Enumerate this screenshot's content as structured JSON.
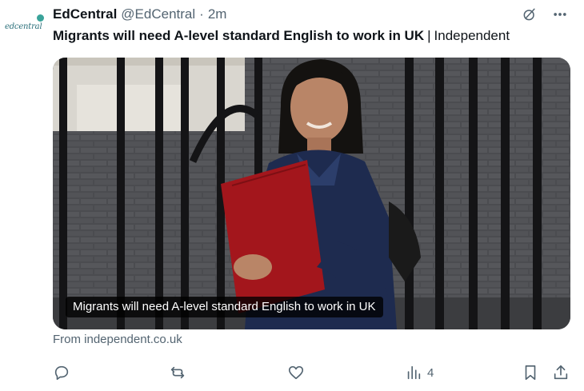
{
  "account": {
    "logo_text": "edcentral",
    "name": "EdCentral",
    "handle": "@EdCentral",
    "separator": "·",
    "time": "2m"
  },
  "header_icons": [
    "grok-icon",
    "more-icon"
  ],
  "tweet": {
    "headline": "Migrants will need A-level standard English to work in UK",
    "separator": "|",
    "publisher": "Independent"
  },
  "card": {
    "caption": "Migrants will need A-level standard English to work in UK",
    "source": "From independent.co.uk"
  },
  "actions": {
    "reply_count": "",
    "repost_count": "",
    "like_count": "",
    "views_count": "4"
  },
  "colors": {
    "text": "#0f1419",
    "muted": "#536471",
    "folder": "#a3161c",
    "jacket": "#1e2b4f"
  }
}
